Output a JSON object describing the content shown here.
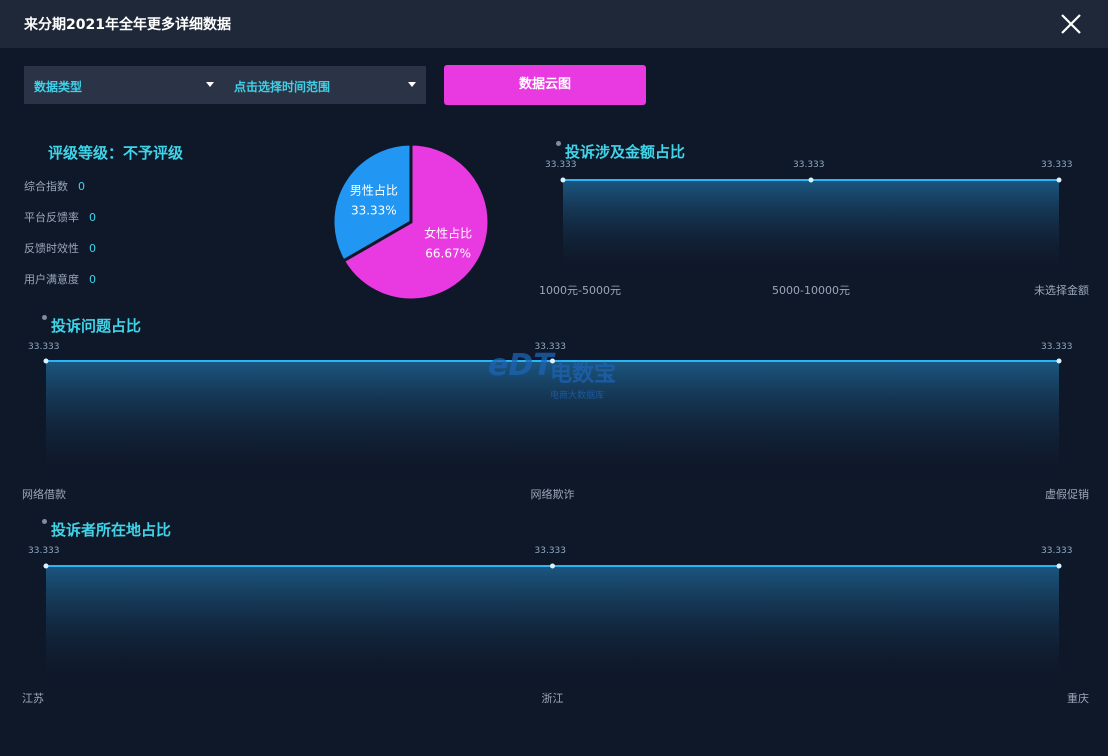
{
  "window": {
    "title": "来分期2021年全年更多详细数据",
    "close_icon": "close-icon"
  },
  "filters": {
    "data_type": "数据类型",
    "time_range": "点击选择时间范围",
    "cloud_button": "数据云图"
  },
  "rating": {
    "title": "评级等级：不予评级",
    "metrics": [
      {
        "label": "综合指数",
        "value": "0"
      },
      {
        "label": "平台反馈率",
        "value": "0"
      },
      {
        "label": "反馈时效性",
        "value": "0"
      },
      {
        "label": "用户满意度",
        "value": "0"
      }
    ]
  },
  "gender_pie": {
    "slices": [
      {
        "label": "男性占比",
        "value_label": "33.33%",
        "value": 33.33,
        "color": "#2196f3"
      },
      {
        "label": "女性占比",
        "value_label": "66.67%",
        "value": 66.67,
        "color": "#e83ae0"
      }
    ]
  },
  "chart_data": [
    {
      "type": "area",
      "title": "投诉涉及金额占比",
      "categories": [
        "1000元-5000元",
        "5000-10000元",
        "未选择金额"
      ],
      "values": [
        33.333,
        33.333,
        33.333
      ],
      "value_labels": [
        "33.333",
        "33.333",
        "33.333"
      ]
    },
    {
      "type": "area",
      "title": "投诉问题占比",
      "categories": [
        "网络借款",
        "网络欺诈",
        "虚假促销"
      ],
      "values": [
        33.333,
        33.333,
        33.333
      ],
      "value_labels": [
        "33.333",
        "33.333",
        "33.333"
      ]
    },
    {
      "type": "area",
      "title": "投诉者所在地占比",
      "categories": [
        "江苏",
        "浙江",
        "重庆"
      ],
      "values": [
        33.333,
        33.333,
        33.333
      ],
      "value_labels": [
        "33.333",
        "33.333",
        "33.333"
      ]
    }
  ],
  "watermark": {
    "logo": "eDT",
    "brand": "电数宝",
    "sub": "电商大数据库"
  },
  "colors": {
    "accent": "#3fd4e8",
    "button": "#e83ae0",
    "line": "#29b6f6"
  }
}
